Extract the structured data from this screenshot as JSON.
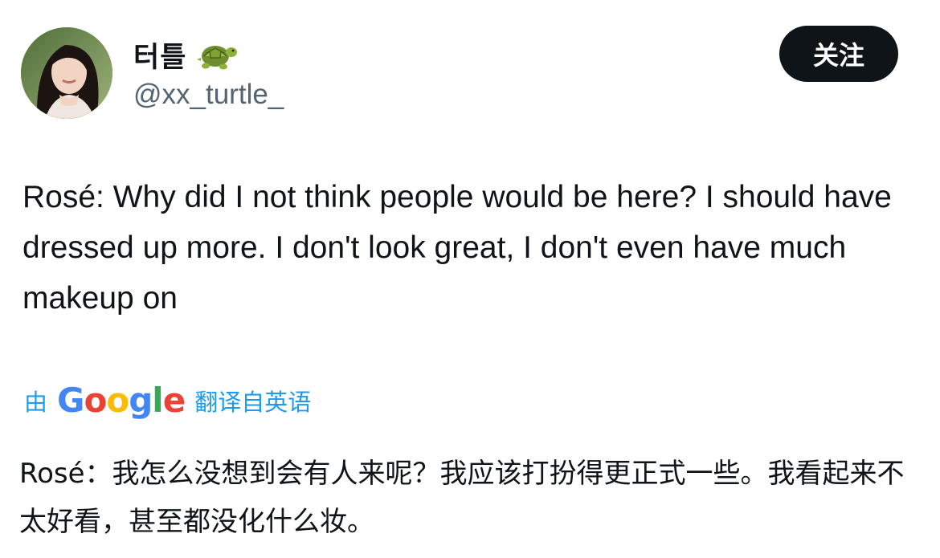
{
  "author": {
    "display_name": "터틀",
    "display_name_emoji": "turtle-emoji",
    "handle": "@xx_turtle_",
    "avatar": "profile-photo"
  },
  "follow_label": "关注",
  "tweet": {
    "text": "Rosé: Why did I not think people would be here? I should have dressed up more. I don't look great, I don't even have much makeup on"
  },
  "translation": {
    "by_label": "由",
    "provider": {
      "letters": [
        "G",
        "o",
        "o",
        "g",
        "l",
        "e"
      ],
      "colors": [
        "#4285F4",
        "#EA4335",
        "#FBBC05",
        "#4285F4",
        "#34A853",
        "#EA4335"
      ]
    },
    "from_label": "翻译自英语",
    "text": "Rosé：我怎么没想到会有人来呢？我应该打扮得更正式一些。我看起来不太好看，甚至都没化什么妆。"
  },
  "colors": {
    "link_blue": "#1d9bf0",
    "text_primary": "#0f1419",
    "text_secondary": "#536471",
    "button_bg": "#0f1419"
  }
}
